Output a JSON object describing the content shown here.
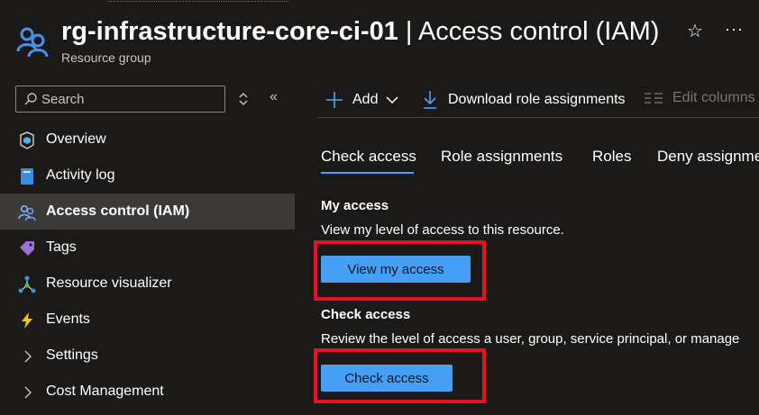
{
  "header": {
    "title_rg": "rg-infrastructure-core-ci-01",
    "title_sep": " | ",
    "title_page": "Access control (IAM)",
    "subtitle": "Resource group",
    "star_icon": "star-outline-icon",
    "more_icon": "more-icon",
    "more_glyph": "···"
  },
  "sidebar": {
    "search_placeholder": "Search",
    "collapse_glyph": "«",
    "items": [
      {
        "label": "Overview",
        "icon": "cube-icon"
      },
      {
        "label": "Activity log",
        "icon": "activity-log-icon"
      },
      {
        "label": "Access control (IAM)",
        "icon": "people-icon",
        "active": true
      },
      {
        "label": "Tags",
        "icon": "tag-icon"
      },
      {
        "label": "Resource visualizer",
        "icon": "visualizer-icon"
      },
      {
        "label": "Events",
        "icon": "lightning-icon"
      },
      {
        "label": "Settings",
        "icon": "chevron-right-icon"
      },
      {
        "label": "Cost Management",
        "icon": "chevron-right-icon"
      }
    ]
  },
  "toolbar": {
    "add_label": "Add",
    "download_label": "Download role assignments",
    "edit_columns_label": "Edit columns"
  },
  "tabs": [
    {
      "label": "Check access",
      "active": true
    },
    {
      "label": "Role assignments"
    },
    {
      "label": "Roles"
    },
    {
      "label": "Deny assignme"
    }
  ],
  "content": {
    "my_access_title": "My access",
    "my_access_desc": "View my level of access to this resource.",
    "view_my_access_button": "View my access",
    "check_access_title": "Check access",
    "check_access_desc": "Review the level of access a user, group, service principal, or manage",
    "check_access_button": "Check access"
  },
  "colors": {
    "accent": "#479ef5",
    "highlight": "#e81123",
    "background": "#1b1a19"
  }
}
